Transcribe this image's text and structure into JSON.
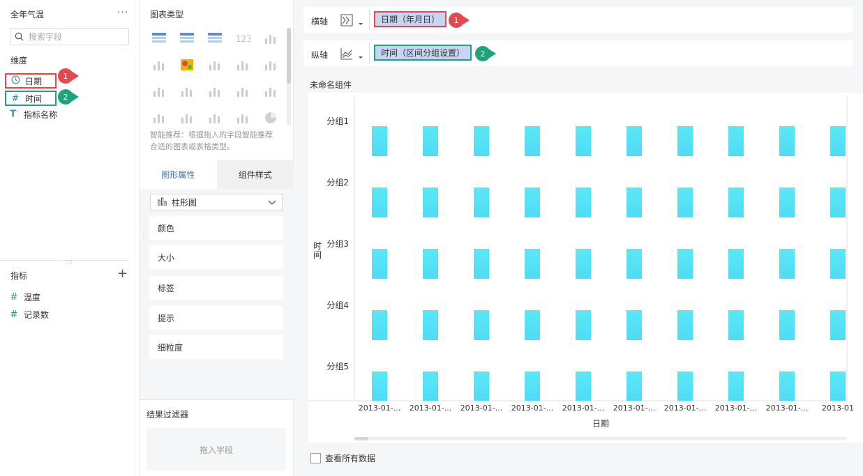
{
  "left": {
    "dataset_title": "全年气温",
    "more": "···",
    "search_placeholder": "搜索字段",
    "dimension_title": "维度",
    "dimensions": [
      {
        "label": "日期",
        "icon": "clock-icon"
      },
      {
        "label": "时间",
        "icon": "hash-icon"
      },
      {
        "label": "指标名称",
        "icon": "text-field-icon"
      }
    ],
    "metric_title": "指标",
    "metrics": [
      {
        "label": "温度",
        "icon_text": "#"
      },
      {
        "label": "记录数",
        "icon_text": "#"
      }
    ]
  },
  "callouts": {
    "one": "1",
    "two": "2"
  },
  "middle": {
    "chart_type_title": "图表类型",
    "recommend_text": "智能推荐：根据拖入的字段智能推荐合适的图表或表格类型。",
    "tabs": {
      "attr": "图形属性",
      "style": "组件样式"
    },
    "chart_select": "柱形图",
    "props": [
      "颜色",
      "大小",
      "标签",
      "提示",
      "细粒度"
    ],
    "filter_title": "结果过滤器",
    "filter_drop": "拖入字段"
  },
  "right": {
    "x_axis_label": "横轴",
    "y_axis_label": "纵轴",
    "x_field": "日期（年月日）",
    "y_field": "时间（区间分组设置）",
    "component_title": "未命名组件",
    "see_all": "查看所有数据"
  },
  "colors": {
    "bar": "#4fdcf5",
    "bar_top": "#5ae8f7",
    "callout_red": "#e5484d",
    "callout_green": "#1fa37c",
    "pill": "#c8d5f2",
    "accent": "#3670c9"
  },
  "chart_data": {
    "type": "bar",
    "xlabel": "日期",
    "ylabel": "时间",
    "x_categories": [
      "2013-01-...",
      "2013-01-...",
      "2013-01-...",
      "2013-01-...",
      "2013-01-...",
      "2013-01-...",
      "2013-01-...",
      "2013-01-...",
      "2013-01-...",
      "2013-01"
    ],
    "y_categories": [
      "分组1",
      "分组2",
      "分组3",
      "分组4",
      "分组5"
    ],
    "grid": false
  }
}
